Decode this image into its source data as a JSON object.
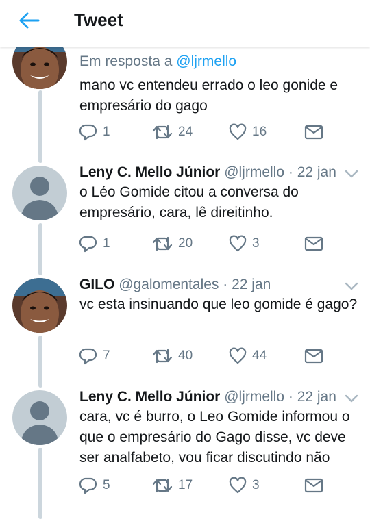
{
  "header": {
    "title": "Tweet"
  },
  "first_reply": {
    "reply_prefix": "Em resposta a",
    "reply_handle": "@ljrmello",
    "text": "mano vc entendeu errado o leo gonide e empresário do gago",
    "replies": "1",
    "retweets": "24",
    "likes": "16"
  },
  "tweets": [
    {
      "name": "Leny C. Mello Júnior",
      "handle": "@ljrmello",
      "time": "· 22 jan",
      "text": "o Léo Gomide citou a conversa do empresário, cara, lê direitinho.",
      "replies": "1",
      "retweets": "20",
      "likes": "3"
    },
    {
      "name": "GILO",
      "handle": "@galomentales",
      "time": "· 22 jan",
      "text": "vc esta insinuando que leo gomide é gago?",
      "replies": "7",
      "retweets": "40",
      "likes": "44"
    },
    {
      "name": "Leny C. Mello Júnior",
      "handle": "@ljrmello",
      "time": "· 22 jan",
      "text": "cara, vc é burro, o Leo Gomide informou o que o empresário do Gago disse, vc deve ser analfabeto, vou ficar discutindo não",
      "replies": "5",
      "retweets": "17",
      "likes": "3"
    }
  ],
  "colors": {
    "accent": "#1da1f2",
    "muted": "#657786",
    "thread_line": "#ccd6dd",
    "default_avatar": "#c2cdd4"
  },
  "icons": [
    "back-arrow-icon",
    "reply-icon",
    "retweet-icon",
    "like-icon",
    "direct-message-icon",
    "chevron-down-icon"
  ]
}
